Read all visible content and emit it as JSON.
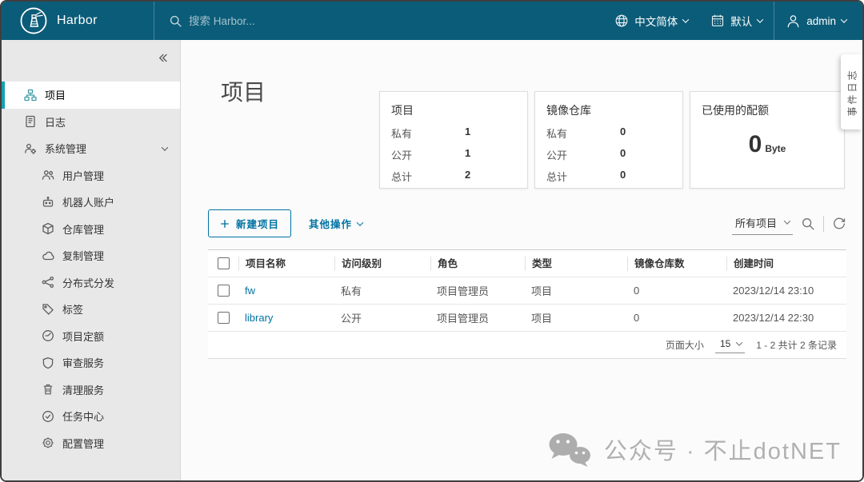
{
  "navbar": {
    "brand": "Harbor",
    "logo_icon": "harbor-lighthouse-logo",
    "search_icon": "search-icon",
    "search_placeholder": "搜索 Harbor...",
    "language_icon": "globe-icon",
    "language": "中文简体",
    "theme_icon": "calendar-icon",
    "theme": "默认",
    "user_icon": "user-icon",
    "user": "admin"
  },
  "sidebar": {
    "collapse_icon": "collapse-double-chevron-icon",
    "items": [
      {
        "label": "项目",
        "icon": "projects-icon",
        "active": true
      },
      {
        "label": "日志",
        "icon": "logs-icon"
      },
      {
        "label": "系统管理",
        "icon": "system-admin-icon",
        "expanded": true
      },
      {
        "label": "用户管理",
        "icon": "users-icon"
      },
      {
        "label": "机器人账户",
        "icon": "robot-icon"
      },
      {
        "label": "仓库管理",
        "icon": "registry-cube-icon"
      },
      {
        "label": "复制管理",
        "icon": "replication-cloud-icon"
      },
      {
        "label": "分布式分发",
        "icon": "distribution-share-icon"
      },
      {
        "label": "标签",
        "icon": "tag-icon"
      },
      {
        "label": "项目定额",
        "icon": "quota-gauge-icon"
      },
      {
        "label": "审查服务",
        "icon": "shield-icon"
      },
      {
        "label": "清理服务",
        "icon": "trash-icon"
      },
      {
        "label": "任务中心",
        "icon": "job-center-icon"
      },
      {
        "label": "配置管理",
        "icon": "gear-icon"
      }
    ]
  },
  "page": {
    "title": "项目"
  },
  "stat_cards": [
    {
      "title": "项目",
      "rows": [
        {
          "label": "私有",
          "value": "1"
        },
        {
          "label": "公开",
          "value": "1"
        },
        {
          "label": "总计",
          "value": "2"
        }
      ]
    },
    {
      "title": "镜像仓库",
      "rows": [
        {
          "label": "私有",
          "value": "0"
        },
        {
          "label": "公开",
          "value": "0"
        },
        {
          "label": "总计",
          "value": "0"
        }
      ]
    }
  ],
  "quota_card": {
    "title": "已使用的配额",
    "value": "0",
    "unit": "Byte"
  },
  "toolbar": {
    "new_project": "新建项目",
    "more_actions": "其他操作",
    "filter_selected": "所有项目",
    "search_icon": "search-icon",
    "refresh_icon": "refresh-icon"
  },
  "table": {
    "columns": [
      "项目名称",
      "访问级别",
      "角色",
      "类型",
      "镜像仓库数",
      "创建时间"
    ],
    "rows": [
      {
        "name": "fw",
        "access": "私有",
        "role": "项目管理员",
        "type": "项目",
        "repo_count": "0",
        "created": "2023/12/14 23:10"
      },
      {
        "name": "library",
        "access": "公开",
        "role": "项目管理员",
        "type": "项目",
        "repo_count": "0",
        "created": "2023/12/14 22:30"
      }
    ],
    "footer": {
      "page_size_label": "页面大小",
      "page_size": "15",
      "records": "1 - 2 共计 2 条记录"
    }
  },
  "event_log_tab": {
    "label": "事件日志"
  },
  "watermark": {
    "icon": "wechat-icon",
    "text": "公众号 · 不止dotNET"
  },
  "colors": {
    "navbar": "#0b5c78",
    "accent": "#0072a3",
    "active_bar": "#16a0af",
    "watermark": "#b0b0b0"
  }
}
